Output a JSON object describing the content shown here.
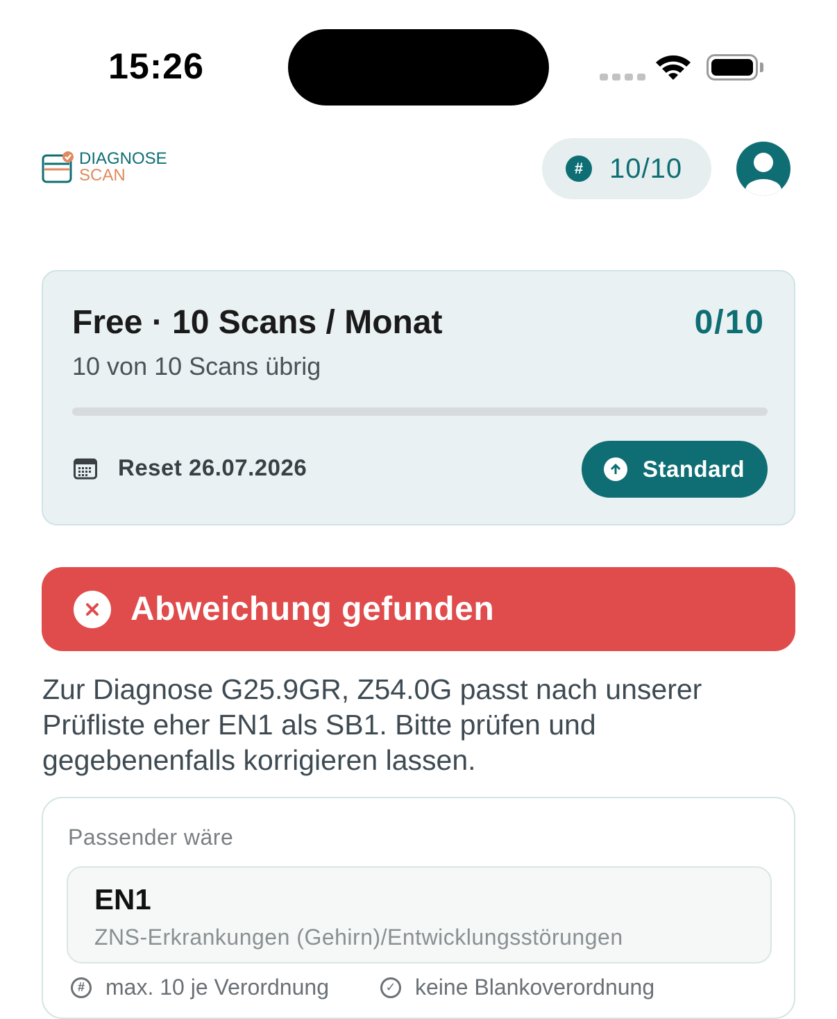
{
  "status_bar": {
    "time": "15:26"
  },
  "header": {
    "logo_line1": "DIAGNOSE",
    "logo_line2": "SCAN",
    "quota_icon": "#",
    "quota_value": "10/10"
  },
  "plan": {
    "title": "Free · 10 Scans / Monat",
    "count": "0/10",
    "subtitle": "10 von 10 Scans übrig",
    "progress": 0,
    "reset_text": "Reset 26.07.2026",
    "upgrade_label": "Standard"
  },
  "alert": {
    "title": "Abweichung gefunden"
  },
  "description": "Zur Diagnose G25.9GR, Z54.0G passt nach unserer Prüfliste eher EN1 als SB1. Bitte prüfen und gegebenenfalls korrigieren lassen.",
  "suggestion": {
    "label": "Passender wäre",
    "code": "EN1",
    "code_description": "ZNS-Erkrankungen (Gehirn)/Entwicklungsstörungen",
    "meta": [
      {
        "icon": "#",
        "text": "max. 10 je Verordnung"
      },
      {
        "icon": "✓",
        "text": "keine Blankoverordnung"
      }
    ]
  },
  "colors": {
    "primary": "#0e6e73",
    "accent": "#e0895f",
    "alert": "#e04b4b",
    "card_bg": "#eaf1f3"
  },
  "icons": [
    "wifi-icon",
    "battery-icon",
    "user-icon",
    "calendar-icon",
    "arrow-up-circle-icon",
    "close-circle-icon",
    "hash-icon",
    "check-circle-icon"
  ]
}
